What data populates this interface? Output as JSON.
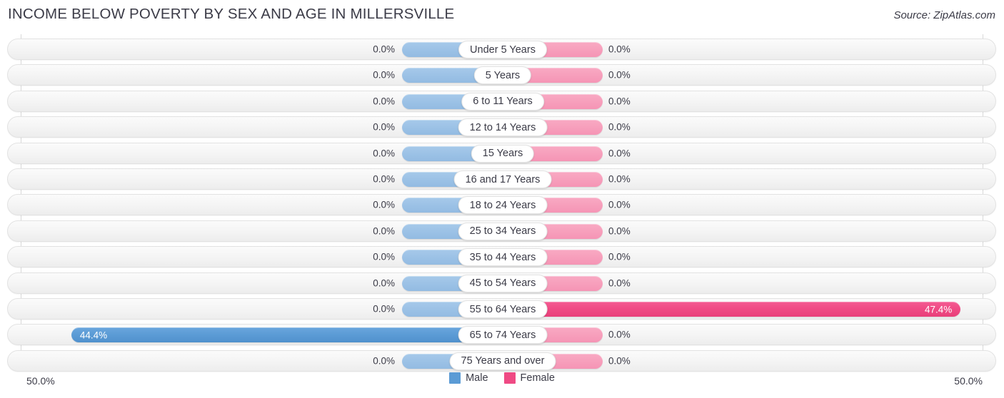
{
  "header": {
    "title": "INCOME BELOW POVERTY BY SEX AND AGE IN MILLERSVILLE",
    "source": "Source: ZipAtlas.com"
  },
  "axis": {
    "left_label": "50.0%",
    "right_label": "50.0%"
  },
  "legend": {
    "items": [
      {
        "label": "Male",
        "color": "#5b9bd5"
      },
      {
        "label": "Female",
        "color": "#ef4a84"
      }
    ]
  },
  "colors": {
    "male": "#5b9bd5",
    "male_zero": "#9cc2e6",
    "female": "#ef4a84",
    "female_zero": "#f79fbc",
    "text": "#3b3b47",
    "track": "#f4f4f4"
  },
  "chart_data": {
    "type": "bar",
    "title": "INCOME BELOW POVERTY BY SEX AND AGE IN MILLERSVILLE",
    "subtitle": "Source: ZipAtlas.com",
    "orientation": "horizontal-diverging",
    "xlabel": "",
    "ylabel": "",
    "xlim": [
      50.0,
      50.0
    ],
    "axis_max_percent": 50.0,
    "grid": false,
    "legend_position": "bottom-center",
    "categories": [
      "Under 5 Years",
      "5 Years",
      "6 to 11 Years",
      "12 to 14 Years",
      "15 Years",
      "16 and 17 Years",
      "18 to 24 Years",
      "25 to 34 Years",
      "35 to 44 Years",
      "45 to 54 Years",
      "55 to 64 Years",
      "65 to 74 Years",
      "75 Years and over"
    ],
    "series": [
      {
        "name": "Male",
        "color": "#5b9bd5",
        "side": "left",
        "values": [
          0.0,
          0.0,
          0.0,
          0.0,
          0.0,
          0.0,
          0.0,
          0.0,
          0.0,
          0.0,
          0.0,
          44.4,
          0.0
        ],
        "labels": [
          "0.0%",
          "0.0%",
          "0.0%",
          "0.0%",
          "0.0%",
          "0.0%",
          "0.0%",
          "0.0%",
          "0.0%",
          "0.0%",
          "0.0%",
          "44.4%",
          "0.0%"
        ]
      },
      {
        "name": "Female",
        "color": "#ef4a84",
        "side": "right",
        "values": [
          0.0,
          0.0,
          0.0,
          0.0,
          0.0,
          0.0,
          0.0,
          0.0,
          0.0,
          0.0,
          47.4,
          0.0,
          0.0
        ],
        "labels": [
          "0.0%",
          "0.0%",
          "0.0%",
          "0.0%",
          "0.0%",
          "0.0%",
          "0.0%",
          "0.0%",
          "0.0%",
          "0.0%",
          "47.4%",
          "0.0%",
          "0.0%"
        ]
      }
    ]
  }
}
